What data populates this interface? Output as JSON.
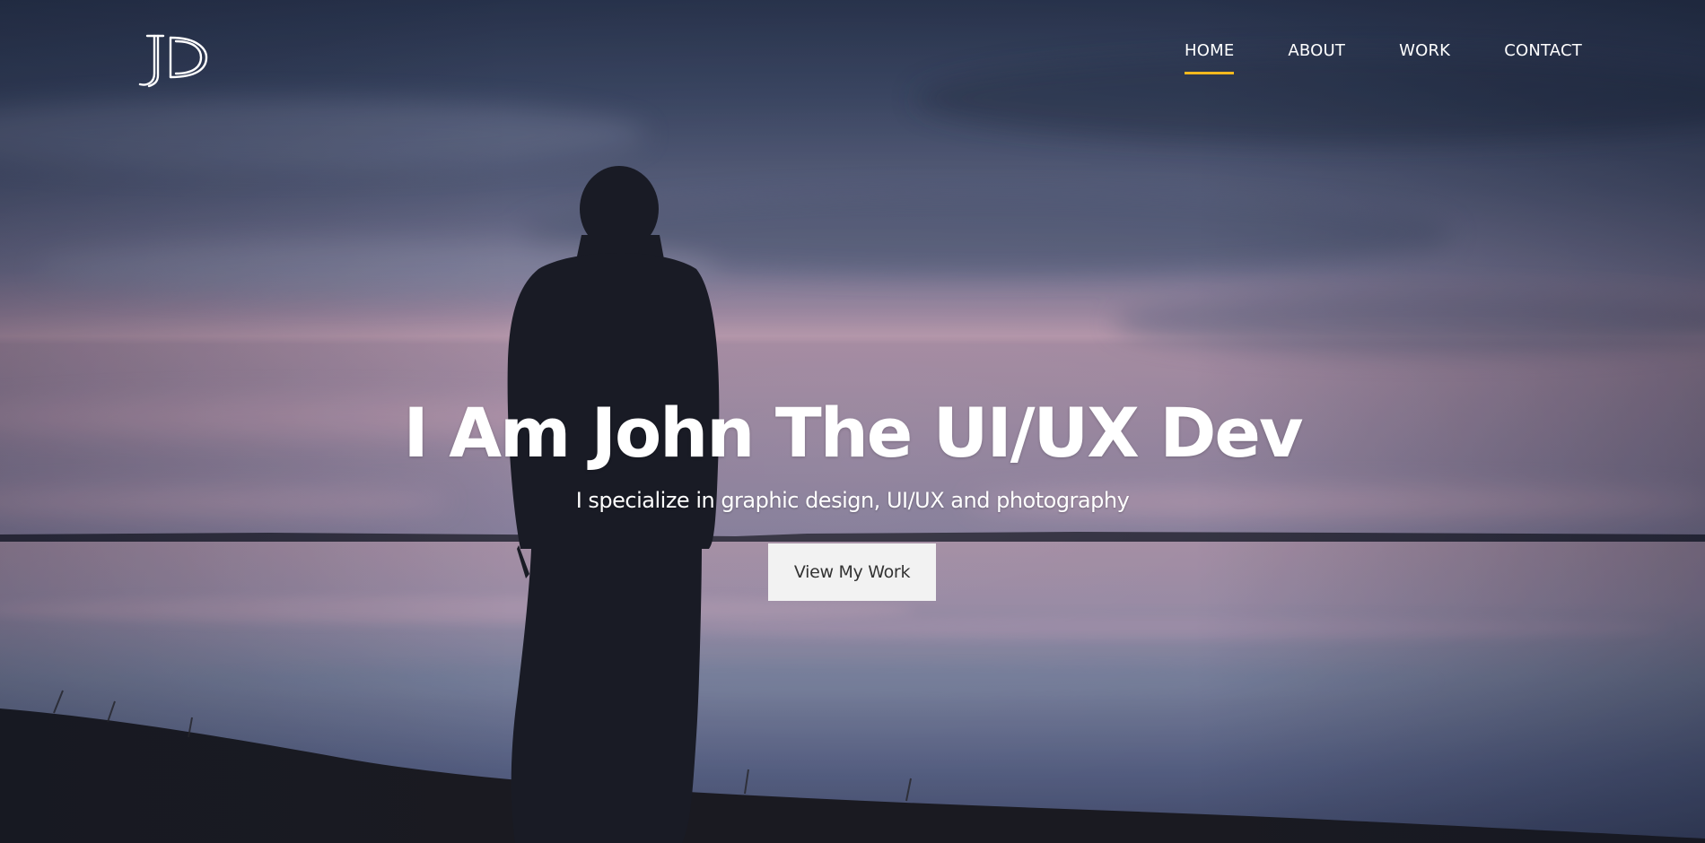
{
  "logo": {
    "text": "JD",
    "icon": "jd-monogram-logo"
  },
  "nav": {
    "items": [
      {
        "label": "HOME",
        "active": true
      },
      {
        "label": "ABOUT",
        "active": false
      },
      {
        "label": "WORK",
        "active": false
      },
      {
        "label": "CONTACT",
        "active": false
      }
    ],
    "active_indicator_color": "#f5b91e"
  },
  "hero": {
    "title": "I Am John The UI/UX Dev",
    "subtitle": "I specialize in graphic design, UI/UX and photography",
    "cta_label": "View My Work",
    "background": "dusk-lake-silhouette-photo"
  },
  "colors": {
    "text": "#ffffff",
    "button_bg": "#f2f2f2",
    "button_text": "#333333",
    "accent": "#f5b91e"
  }
}
